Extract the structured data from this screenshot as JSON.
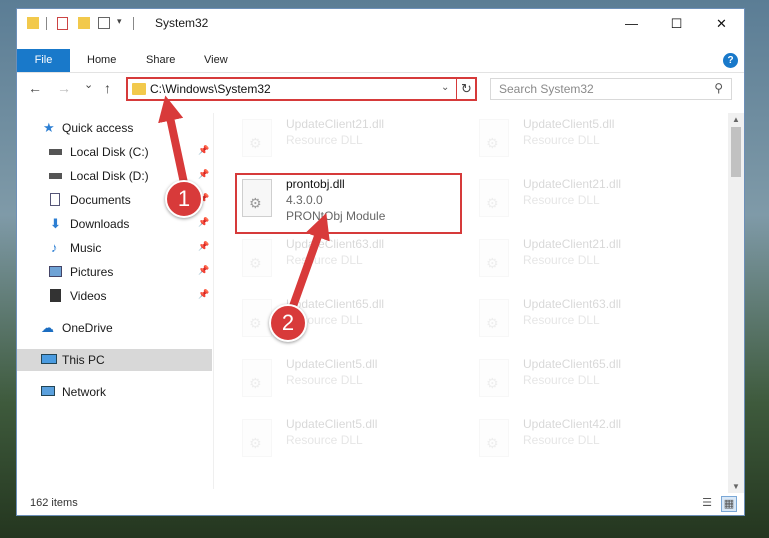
{
  "window": {
    "title": "System32",
    "controls": {
      "minimize": "—",
      "maximize": "☐",
      "close": "✕"
    }
  },
  "ribbon": {
    "tabs": [
      "File",
      "Home",
      "Share",
      "View"
    ],
    "help": "?"
  },
  "nav": {
    "back": "←",
    "forward": "→",
    "recent": "⌄",
    "up": "↑",
    "address": "C:\\Windows\\System32",
    "search_placeholder": "Search System32"
  },
  "sidebar": {
    "items": [
      {
        "label": "Quick access",
        "icon": "star-icon"
      },
      {
        "label": "Local Disk (C:)",
        "icon": "drive-icon",
        "pinned": true
      },
      {
        "label": "Local Disk (D:)",
        "icon": "drive-icon",
        "pinned": true
      },
      {
        "label": "Documents",
        "icon": "documents-icon",
        "pinned": true
      },
      {
        "label": "Downloads",
        "icon": "downloads-icon",
        "pinned": true
      },
      {
        "label": "Music",
        "icon": "music-icon",
        "pinned": true
      },
      {
        "label": "Pictures",
        "icon": "pictures-icon",
        "pinned": true
      },
      {
        "label": "Videos",
        "icon": "videos-icon",
        "pinned": true
      },
      {
        "label": "OneDrive",
        "icon": "cloud-icon"
      },
      {
        "label": "This PC",
        "icon": "computer-icon",
        "selected": true
      },
      {
        "label": "Network",
        "icon": "network-icon"
      }
    ]
  },
  "files": {
    "left": [
      {
        "name": "UpdateClient21.dll",
        "desc": "Resource DLL"
      },
      {
        "name": "prontobj.dll",
        "version": "4.3.0.0",
        "desc": "PRONtObj Module"
      },
      {
        "name": "UpdateClient63.dll",
        "desc": "Resource DLL"
      },
      {
        "name": "UpdateClient65.dll",
        "desc": "Resource DLL"
      },
      {
        "name": "UpdateClient5.dll",
        "desc": "Resource DLL"
      },
      {
        "name": "UpdateClient5.dll",
        "desc": "Resource DLL"
      }
    ],
    "right": [
      {
        "name": "UpdateClient5.dll",
        "desc": "Resource DLL"
      },
      {
        "name": "UpdateClient21.dll",
        "desc": "Resource DLL"
      },
      {
        "name": "UpdateClient21.dll",
        "desc": "Resource DLL"
      },
      {
        "name": "UpdateClient63.dll",
        "desc": "Resource DLL"
      },
      {
        "name": "UpdateClient65.dll",
        "desc": "Resource DLL"
      },
      {
        "name": "UpdateClient42.dll",
        "desc": "Resource DLL"
      }
    ]
  },
  "status": {
    "item_count": "162 items"
  },
  "callouts": {
    "one": "1",
    "two": "2"
  },
  "colors": {
    "accent": "#1979ca",
    "annotation": "#d63a3a",
    "folder": "#f2c94c"
  }
}
